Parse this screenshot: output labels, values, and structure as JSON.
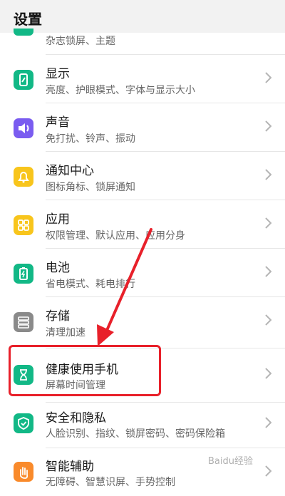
{
  "header": {
    "title": "设置"
  },
  "partial_item": {
    "sub": "杂志锁屏、主题"
  },
  "items": [
    {
      "label": "显示",
      "sub": "亮度、护眼模式、字体与显示大小",
      "color": "#12b886",
      "icon": "display-icon"
    },
    {
      "label": "声音",
      "sub": "免打扰、铃声、振动",
      "color": "#7a5cf0",
      "icon": "sound-icon"
    },
    {
      "label": "通知中心",
      "sub": "图标角标、锁屏通知",
      "color": "#f8c51c",
      "icon": "notification-icon"
    },
    {
      "label": "应用",
      "sub": "权限管理、默认应用、应用分身",
      "color": "#f8c51c",
      "icon": "apps-icon"
    },
    {
      "label": "电池",
      "sub": "省电模式、耗电排行",
      "color": "#12b886",
      "icon": "battery-icon"
    },
    {
      "label": "存储",
      "sub": "清理加速",
      "color": "#8a8a8a",
      "icon": "storage-icon"
    },
    {
      "label": "健康使用手机",
      "sub": "屏幕时间管理",
      "color": "#12b886",
      "icon": "hourglass-icon"
    },
    {
      "label": "安全和隐私",
      "sub": "人脸识别、指纹、锁屏密码、密码保险箱",
      "color": "#12b886",
      "icon": "shield-icon"
    },
    {
      "label": "智能辅助",
      "sub": "无障碍、智慧识屏、手势控制",
      "color": "#f98a2b",
      "icon": "hand-icon"
    }
  ],
  "watermark": "Baidu经验"
}
